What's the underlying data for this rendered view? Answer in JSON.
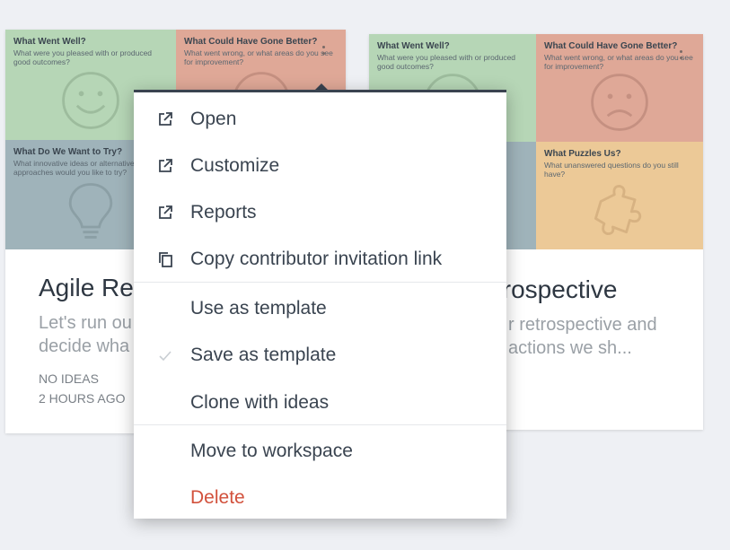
{
  "cards": [
    {
      "title": "Agile Re",
      "desc_line1": "Let's run ou",
      "desc_line2": "decide wha",
      "ideas": "NO IDEAS",
      "time": "2 HOURS AGO",
      "quadrants": [
        {
          "title": "What Went Well?",
          "desc": "What were you pleased with or produced good outcomes?",
          "icon": "smiley-icon"
        },
        {
          "title": "What Could Have Gone Better?",
          "desc": "What went wrong, or what areas do you see for improvement?",
          "icon": "frown-icon"
        },
        {
          "title": "What Do We Want to Try?",
          "desc": "What innovative ideas or alternative approaches would you like to try?",
          "icon": "lightbulb-icon"
        },
        {
          "title": "",
          "desc": "",
          "icon": ""
        }
      ]
    },
    {
      "title": "trospective",
      "desc_line1": "r retrospective and",
      "desc_line2": "actions we sh...",
      "quadrants": [
        {
          "title": "What Went Well?",
          "desc": "What were you pleased with or produced good outcomes?",
          "icon": "smiley-icon"
        },
        {
          "title": "What Could Have Gone Better?",
          "desc": "What went wrong, or what areas do you see for improvement?",
          "icon": "frown-icon"
        },
        {
          "title": "",
          "desc": "",
          "icon": ""
        },
        {
          "title": "What Puzzles Us?",
          "desc": "What unanswered questions do you still have?",
          "icon": "puzzle-icon"
        }
      ]
    }
  ],
  "menu": {
    "items": [
      {
        "label": "Open",
        "icon": "external-link-icon"
      },
      {
        "label": "Customize",
        "icon": "external-link-icon"
      },
      {
        "label": "Reports",
        "icon": "external-link-icon"
      },
      {
        "label": "Copy contributor invitation link",
        "icon": "copy-icon"
      },
      {
        "label": "Use as template",
        "icon": ""
      },
      {
        "label": "Save as template",
        "icon": "checkmark-icon"
      },
      {
        "label": "Clone with ideas",
        "icon": ""
      },
      {
        "label": "Move to workspace",
        "icon": ""
      },
      {
        "label": "Delete",
        "icon": ""
      }
    ]
  },
  "colors": {
    "green": "#b6d6b6",
    "red": "#dfa897",
    "blue": "#9fb3ba",
    "yellow": "#ecc997",
    "menu_accent": "#3a4350",
    "danger": "#d2513c"
  }
}
